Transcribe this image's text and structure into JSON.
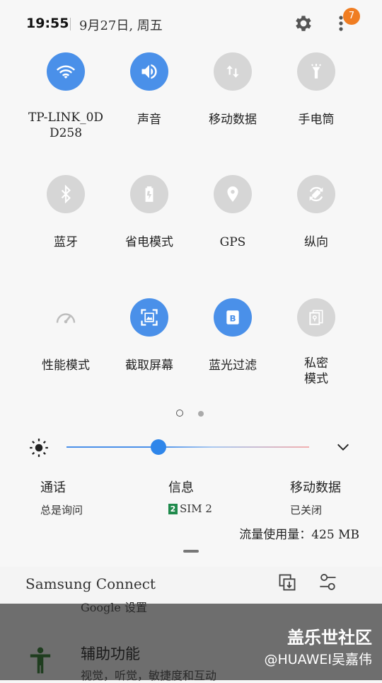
{
  "status": {
    "time": "19:55",
    "date": "9月27日, 周五",
    "badge": "7",
    "settings_icon": "gear-icon",
    "more_icon": "more-vert-icon"
  },
  "colors": {
    "accent": "#4a90e9",
    "tile_off": "#d6d6d6",
    "badge": "#f07d22",
    "sim": "#1f8a4c"
  },
  "tiles": [
    {
      "label": "TP-LINK_0D\nD258",
      "state": "on",
      "icon": "wifi-icon"
    },
    {
      "label": "声音",
      "state": "on",
      "icon": "sound-icon"
    },
    {
      "label": "移动数据",
      "state": "off",
      "icon": "mobile-data-icon"
    },
    {
      "label": "手电筒",
      "state": "off",
      "icon": "flashlight-icon"
    },
    {
      "label": "蓝牙",
      "state": "off",
      "icon": "bluetooth-icon"
    },
    {
      "label": "省电模式",
      "state": "off",
      "icon": "power-saving-icon"
    },
    {
      "label": "GPS",
      "state": "off",
      "icon": "location-icon"
    },
    {
      "label": "纵向",
      "state": "off",
      "icon": "rotate-icon"
    },
    {
      "label": "性能模式",
      "state": "off",
      "icon": "performance-icon"
    },
    {
      "label": "截取屏幕",
      "state": "on",
      "icon": "screenshot-icon"
    },
    {
      "label": "蓝光过滤",
      "state": "on",
      "icon": "blue-light-filter-icon"
    },
    {
      "label": "私密\n模式",
      "state": "off",
      "icon": "private-mode-icon"
    }
  ],
  "pager": {
    "pages": 2,
    "current": 1
  },
  "brightness": {
    "level": 0.38
  },
  "sim": {
    "call": {
      "title": "通话",
      "value": "总是询问"
    },
    "message": {
      "title": "信息",
      "sim_number": "2",
      "value": "SIM 2"
    },
    "data": {
      "title": "移动数据",
      "value": "已关闭"
    },
    "usage": "流量使用量：425 MB"
  },
  "connect": {
    "title": "Samsung Connect"
  },
  "background_list": {
    "google": "Google 设置",
    "accessibility_title": "辅助功能",
    "accessibility_sub": "视觉，听觉，敏捷度和互动"
  },
  "watermark": {
    "line1": "盖乐世社区",
    "line2": "@HUAWEI吴嘉伟"
  }
}
